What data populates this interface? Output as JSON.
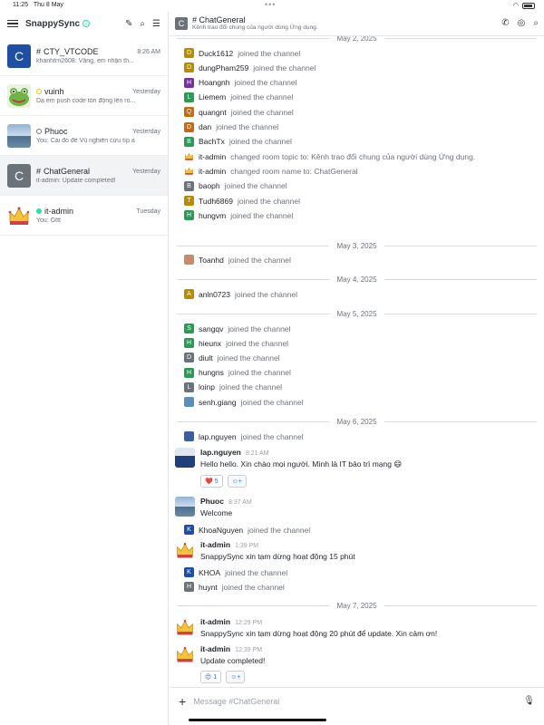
{
  "status": {
    "time": "11:25",
    "date": "Thu 8 May",
    "battery": ""
  },
  "sidebar": {
    "workspace": "SnappySync",
    "rooms": [
      {
        "name": "CTY_VTCODE",
        "date": "8:26 AM",
        "last": "khanhtrn2608: Vâng, em nhận th...",
        "avatar_letter": "C",
        "avatar_color": "#1d4fa5",
        "prefix": "#",
        "status": ""
      },
      {
        "name": "vuinh",
        "date": "Yesterday",
        "last": "Dạ em push code tồn động lên rồ...",
        "avatar_letter": "",
        "avatar_color": "#6fb546",
        "prefix": "",
        "status": "away"
      },
      {
        "name": "Phuoc",
        "date": "Yesterday",
        "last": "You: Cái đó để Vũ nghiên cứu tìp a",
        "avatar_letter": "",
        "avatar_color": "#7aa3c8",
        "prefix": "",
        "status": "offline"
      },
      {
        "name": "ChatGeneral",
        "date": "Yesterday",
        "last": "it-admin: Update completed!",
        "avatar_letter": "C",
        "avatar_color": "#6c727a",
        "prefix": "#",
        "status": ""
      },
      {
        "name": "it-admin",
        "date": "Tuesday",
        "last": "You: Gttt",
        "avatar_letter": "",
        "avatar_color": "#f5c33b",
        "prefix": "",
        "status": "online"
      }
    ]
  },
  "header": {
    "title": "ChatGeneral",
    "topic": "Kênh trao đổi chung của người dùng Ứng dụng."
  },
  "feed": {
    "date1": "May 2, 2025",
    "date2": "May 3, 2025",
    "date3": "May 4, 2025",
    "date4": "May 5, 2025",
    "date5": "May 6, 2025",
    "date6": "May 7, 2025",
    "joined": "joined the channel",
    "sys": [
      {
        "user": "Duck1612",
        "letter": "D",
        "color": "#b68d00",
        "text": "joined the channel"
      },
      {
        "user": "dungPham259",
        "letter": "D",
        "color": "#b68d00",
        "text": "joined the channel"
      },
      {
        "user": "Hoangnh",
        "letter": "H",
        "color": "#7a2fa5",
        "text": "joined the channel"
      },
      {
        "user": "Liemem",
        "letter": "L",
        "color": "#2a9a55",
        "text": "joined the channel"
      },
      {
        "user": "quangnt",
        "letter": "Q",
        "color": "#c46a10",
        "text": "joined the channel"
      },
      {
        "user": "dan",
        "letter": "D",
        "color": "#c46a10",
        "text": "joined the channel"
      },
      {
        "user": "BachTx",
        "letter": "B",
        "color": "#2a9a55",
        "text": "joined the channel"
      },
      {
        "user": "it-admin",
        "letter": "",
        "color": "#f5c33b",
        "text": "changed room topic to: Kênh trao đổi chung của người dùng Ứng dụng."
      },
      {
        "user": "it-admin",
        "letter": "",
        "color": "#f5c33b",
        "text": "changed room name to: ChatGeneral"
      },
      {
        "user": "baoph",
        "letter": "B",
        "color": "#6c727a",
        "text": "joined the channel"
      },
      {
        "user": "Tudh6869",
        "letter": "T",
        "color": "#b68d00",
        "text": "joined the channel"
      },
      {
        "user": "hungvm",
        "letter": "H",
        "color": "#2a9a55",
        "text": "joined the channel"
      },
      {
        "user": "Toanhd",
        "letter": "",
        "color": "#c98a6a",
        "text": "joined the channel"
      },
      {
        "user": "anln0723",
        "letter": "A",
        "color": "#b68d00",
        "text": "joined the channel"
      },
      {
        "user": "sangqv",
        "letter": "S",
        "color": "#2a9a55",
        "text": "joined the channel"
      },
      {
        "user": "hieunx",
        "letter": "H",
        "color": "#2a9a55",
        "text": "joined the channel"
      },
      {
        "user": "diult",
        "letter": "D",
        "color": "#6c727a",
        "text": "joined the channel"
      },
      {
        "user": "hungns",
        "letter": "H",
        "color": "#2a9a55",
        "text": "joined the channel"
      },
      {
        "user": "loinp",
        "letter": "L",
        "color": "#6c727a",
        "text": "joined the channel"
      },
      {
        "user": "senh.giang",
        "letter": "",
        "color": "#5a8fb8",
        "text": "joined the channel"
      },
      {
        "user": "lap.nguyen",
        "letter": "",
        "color": "#3a5fa0",
        "text": "joined the channel"
      },
      {
        "user": "KhoaNguyen",
        "letter": "K",
        "color": "#1d4fa5",
        "text": "joined the channel"
      },
      {
        "user": "KHOA",
        "letter": "K",
        "color": "#1d4fa5",
        "text": "joined the channel"
      },
      {
        "user": "huynt",
        "letter": "H",
        "color": "#6c727a",
        "text": "joined the channel"
      }
    ],
    "messages": [
      {
        "user": "lap.nguyen",
        "time": "8:21 AM",
        "body": "Hello hello. Xin chào mọi người. Mình là IT bảo trì mạng 😄",
        "react_emoji": "❤️",
        "react_count": "5"
      },
      {
        "user": "Phuoc",
        "time": "8:37 AM",
        "body": "Welcome"
      },
      {
        "user": "it-admin",
        "time": "1:39 PM",
        "body": "SnappySync xin tạm dừng hoạt động 15 phút"
      },
      {
        "user": "it-admin",
        "time": "12:29 PM",
        "body": "SnappySync xin tạm dừng hoạt động 20 phút để update. Xin cảm ơn!"
      },
      {
        "user": "it-admin",
        "time": "12:39 PM",
        "body": "Update completed!",
        "react_emoji": "😍",
        "react_count": "1"
      }
    ]
  },
  "composer": {
    "placeholder": "Message #ChatGeneral"
  }
}
